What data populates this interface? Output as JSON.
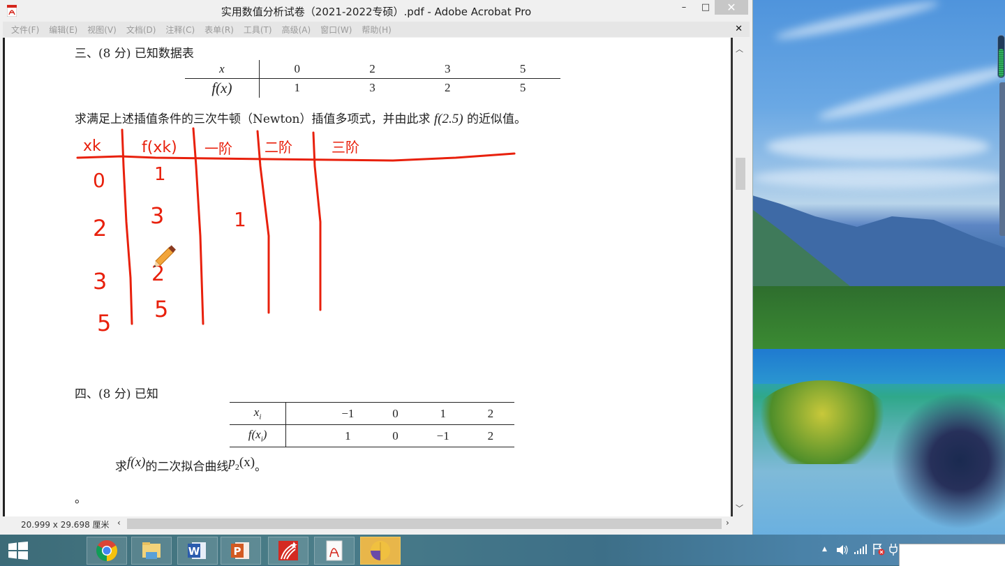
{
  "window": {
    "title": "实用数值分析试卷（2021-2022专硕）.pdf - Adobe Acrobat Pro",
    "minimize_label": "–",
    "maximize_label": "□",
    "close_label": "✕"
  },
  "menubar": {
    "items": [
      "文件(F)",
      "编辑(E)",
      "视图(V)",
      "文档(D)",
      "注释(C)",
      "表单(R)",
      "工具(T)",
      "高级(A)",
      "窗口(W)",
      "帮助(H)"
    ],
    "doc_close_label": "✕"
  },
  "document": {
    "q3": {
      "heading": "三、(8 分) 已知数据表",
      "table": {
        "row1_label": "x",
        "row1_values": [
          "0",
          "2",
          "3",
          "5"
        ],
        "row2_label": "f(x)",
        "row2_values": [
          "1",
          "3",
          "2",
          "5"
        ]
      },
      "prompt_pre": "求满足上述插值条件的三次牛顿（Newton）插值多项式，并由此求 ",
      "prompt_expr": "f(2.5)",
      "prompt_post": " 的近似值。"
    },
    "annotation": {
      "color": "#e8200c",
      "headers": [
        "xk",
        "f(xk)",
        "一阶",
        "二阶",
        "三阶"
      ],
      "x_values": [
        "0",
        "2",
        "3",
        "5"
      ],
      "f_values": [
        "1",
        "3",
        "2",
        "5"
      ],
      "first_order": [
        "1"
      ]
    },
    "q4": {
      "heading": "四、(8 分) 已知",
      "table": {
        "row1_label": "x_i",
        "row1_values": [
          "−1",
          "0",
          "1",
          "2"
        ],
        "row2_label": "f(x_i)",
        "row2_values": [
          "1",
          "0",
          "−1",
          "2"
        ]
      },
      "prompt_pre": "求",
      "prompt_fx": "f(x)",
      "prompt_mid": "的二次拟合曲线",
      "prompt_p": "p",
      "prompt_sub": "2",
      "prompt_px": "(x)",
      "prompt_post": "。"
    },
    "stray_mark": "。"
  },
  "statusbar": {
    "page_size": "20.999 x 29.698 厘米",
    "scroll_left": "‹",
    "scroll_right": "›"
  },
  "scrollbar": {
    "up": "︿",
    "down": "﹀"
  },
  "taskbar": {
    "apps": [
      "Chrome",
      "File Explorer",
      "Word",
      "PowerPoint",
      "Chaoxing",
      "Adobe Acrobat",
      "Presentation Tool"
    ],
    "active_app": "Presentation Tool"
  },
  "tray": {
    "show_hidden_label": "▲",
    "icons": [
      "volume",
      "network-signal",
      "action-center-flag",
      "power"
    ]
  }
}
